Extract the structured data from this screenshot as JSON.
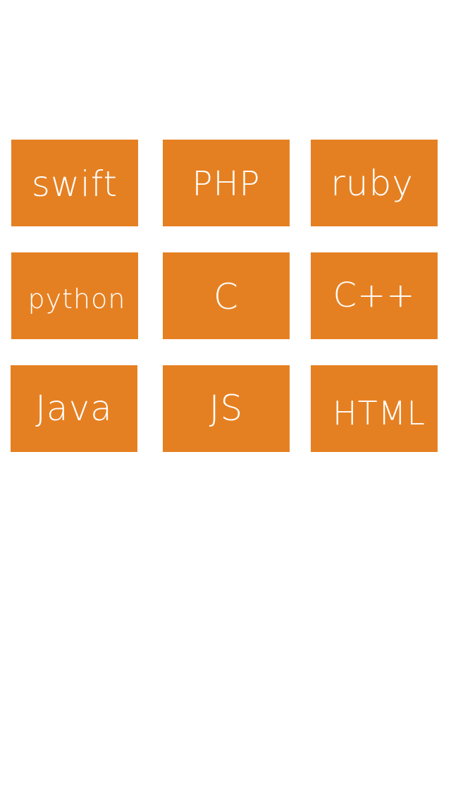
{
  "colors": {
    "tile_background": "#E58022",
    "tile_text": "#FFFFFF",
    "page_background": "#FFFFFF"
  },
  "tiles": [
    {
      "label": "swift"
    },
    {
      "label": "PHP"
    },
    {
      "label": "ruby"
    },
    {
      "label": "python"
    },
    {
      "label": "C"
    },
    {
      "label": "C++"
    },
    {
      "label": "Java"
    },
    {
      "label": "JS"
    },
    {
      "label": "HTML"
    }
  ]
}
